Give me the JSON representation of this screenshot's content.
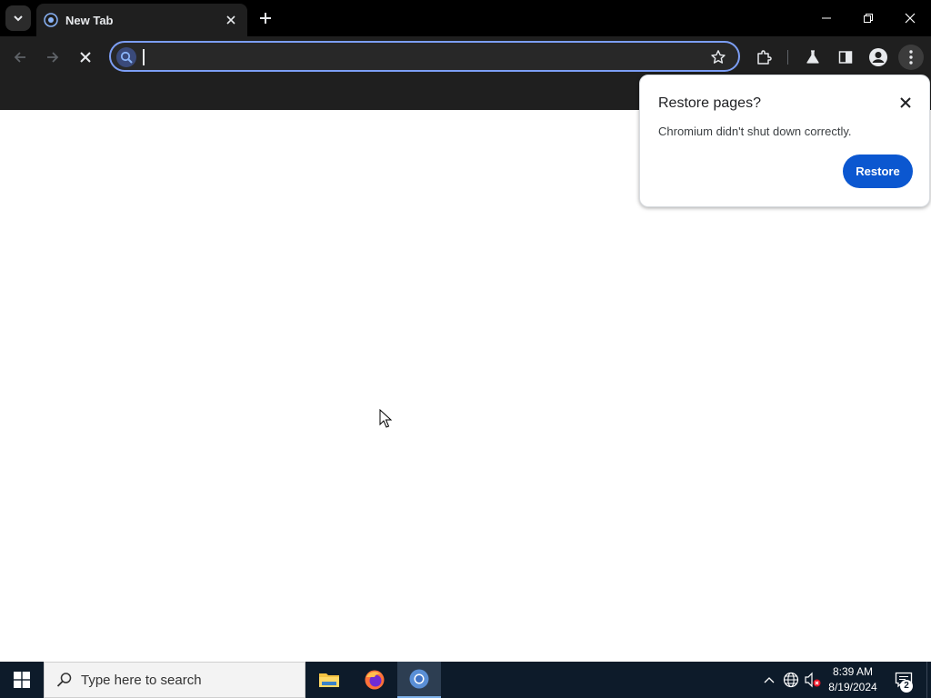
{
  "browser": {
    "tab": {
      "title": "New Tab"
    },
    "omnibox": {
      "value": "",
      "placeholder": ""
    }
  },
  "restore_bubble": {
    "title": "Restore pages?",
    "message": "Chromium didn't shut down correctly.",
    "button_label": "Restore"
  },
  "taskbar": {
    "search_placeholder": "Type here to search",
    "time": "8:39 AM",
    "date": "8/19/2024",
    "notification_count": "2",
    "pinned_apps": [
      "file-explorer",
      "firefox",
      "chromium"
    ]
  },
  "colors": {
    "tabstrip": "#000000",
    "toolbar": "#1f1f1f",
    "omnibox_border": "#7c9ef5",
    "restore_button": "#0b57d0",
    "taskbar": "#0d1b2a"
  }
}
